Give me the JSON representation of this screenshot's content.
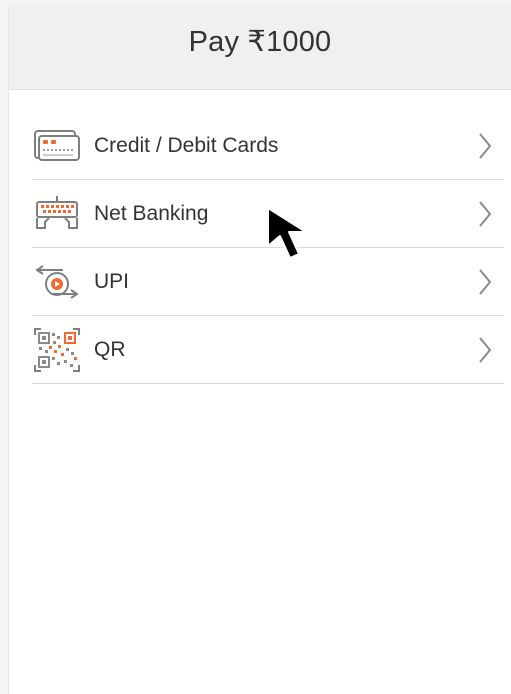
{
  "header": {
    "title": "Pay ₹1000"
  },
  "methods": [
    {
      "label": "Credit / Debit Cards",
      "icon": "credit-card-icon"
    },
    {
      "label": "Net Banking",
      "icon": "net-banking-icon"
    },
    {
      "label": "UPI",
      "icon": "upi-icon"
    },
    {
      "label": "QR",
      "icon": "qr-code-icon"
    }
  ],
  "colors": {
    "accent": "#f26a2e",
    "icon_stroke": "#7f7f7f",
    "text": "#333333",
    "header_bg": "#f0f0f0",
    "divider": "#dcdcdc"
  }
}
